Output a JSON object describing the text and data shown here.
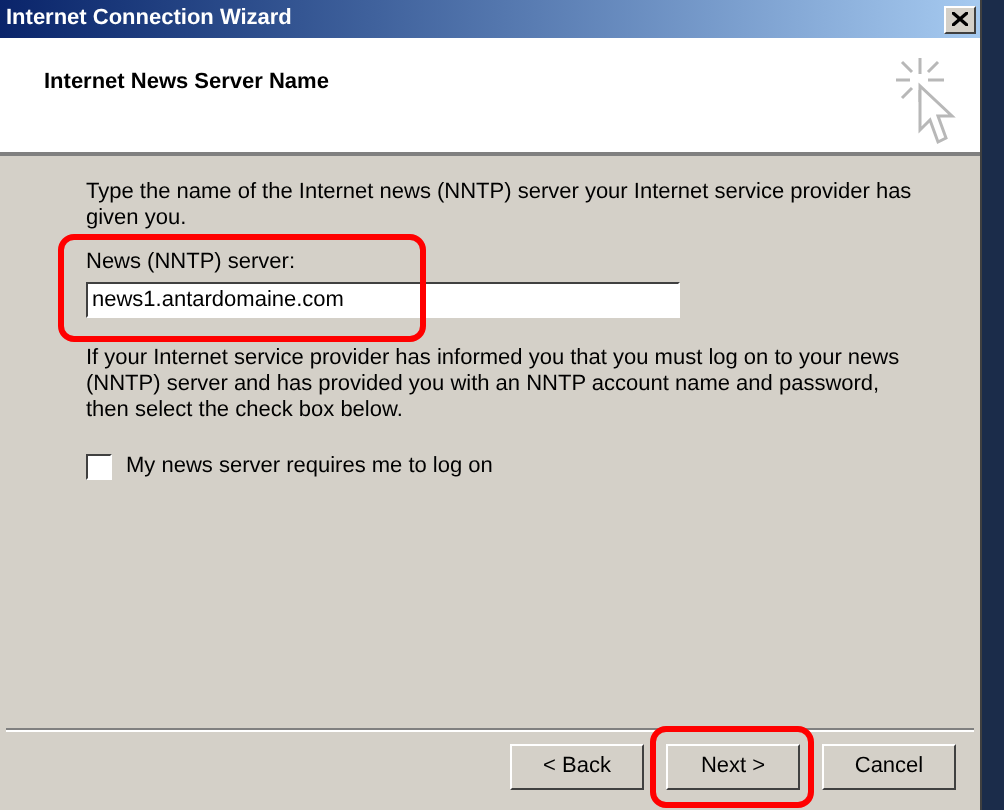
{
  "window": {
    "title": "Internet Connection Wizard"
  },
  "header": {
    "title": "Internet News Server Name"
  },
  "intro": "Type the name of the Internet news (NNTP) server your Internet service provider has given you.",
  "server_field": {
    "label": "News (NNTP) server:",
    "value": "news1.antardomaine.com"
  },
  "logon_note": "If your Internet service provider has informed you that you must log on to your news (NNTP) server and has provided you with an NNTP account name and password, then select the check box below.",
  "logon_checkbox": {
    "label": "My news server requires me to log on",
    "checked": false
  },
  "buttons": [
    "< Back",
    "Next >",
    "Cancel"
  ]
}
